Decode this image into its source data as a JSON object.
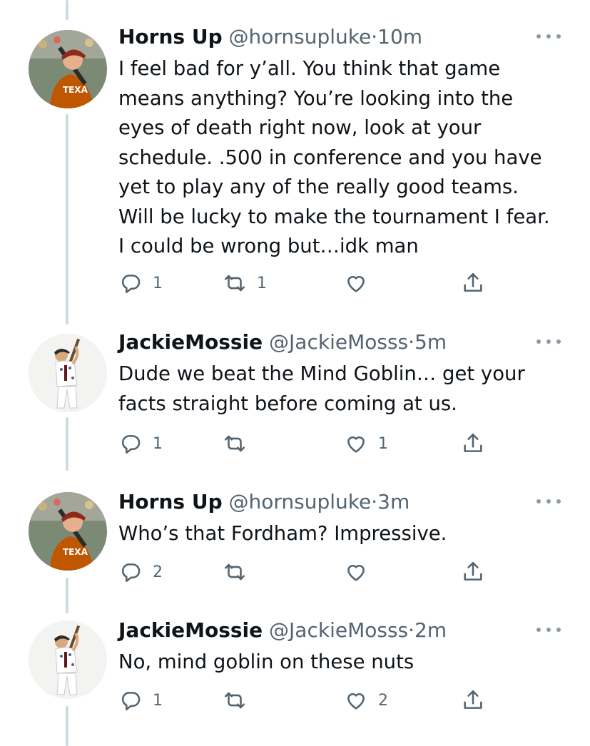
{
  "tweets": [
    {
      "name": "Horns Up",
      "handle": "@hornsupluke",
      "dot": "·",
      "time": "10m",
      "avatar": "texas-baseball-player-avatar",
      "text": "I feel bad for y’all. You think that game\nmeans anything? You’re looking into the\neyes of death right now, look at your\nschedule. .500 in conference and you have\nyet to play any of the really good teams.\nWill be lucky to make the tournament I fear.\nI could be wrong but…idk man",
      "replies": "1",
      "retweets": "1",
      "likes": ""
    },
    {
      "name": "JackieMossie",
      "handle": "@JackieMosss",
      "dot": "·",
      "time": "5m",
      "avatar": "batter-swinging-avatar",
      "text": "Dude we beat the Mind Goblin… get your\nfacts straight before coming at us.",
      "replies": "1",
      "retweets": "",
      "likes": "1"
    },
    {
      "name": "Horns Up",
      "handle": "@hornsupluke",
      "dot": "·",
      "time": "3m",
      "avatar": "texas-baseball-player-avatar",
      "text": "Who’s that Fordham? Impressive.",
      "replies": "2",
      "retweets": "",
      "likes": ""
    },
    {
      "name": "JackieMossie",
      "handle": "@JackieMosss",
      "dot": "·",
      "time": "2m",
      "avatar": "batter-swinging-avatar",
      "text": "No, mind goblin on these nuts",
      "replies": "1",
      "retweets": "",
      "likes": "2"
    }
  ],
  "colors": {
    "text": "#0f1419",
    "secondary": "#536471",
    "thread_line": "#cfd9de",
    "texas_orange": "#bf5700"
  }
}
